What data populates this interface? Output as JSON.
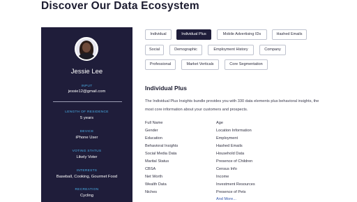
{
  "page": {
    "title": "Discover Our Data Ecosystem"
  },
  "profile": {
    "name": "Jessie Lee",
    "fields": [
      {
        "label": "Input",
        "value": "jessie12@gmail.com"
      },
      {
        "label": "Length of Residence",
        "value": "5 years"
      },
      {
        "label": "Device",
        "value": "iPhone User"
      },
      {
        "label": "Voting Status",
        "value": "Likely Voter"
      },
      {
        "label": "Interests",
        "value": "Baseball, Cooking, Gourmet Food"
      },
      {
        "label": "Recreation",
        "value": "Cycling"
      }
    ]
  },
  "tags": [
    {
      "label": "Individual",
      "active": false
    },
    {
      "label": "Individual Plus",
      "active": true
    },
    {
      "label": "Mobile Advertising IDs",
      "active": false
    },
    {
      "label": "Hashed Emails",
      "active": false
    },
    {
      "label": "Social",
      "active": false
    },
    {
      "label": "Demographic",
      "active": false
    },
    {
      "label": "Employment History",
      "active": false
    },
    {
      "label": "Company",
      "active": false
    },
    {
      "label": "Professional",
      "active": false
    },
    {
      "label": "Market Verticals",
      "active": false
    },
    {
      "label": "Core Segmentation",
      "active": false
    }
  ],
  "section": {
    "title": "Individual Plus",
    "description": "The Individual Plus Insights bundle provides you with 330 data elements plus behavioral insights, the most core information about your customers and prospects.",
    "left_attributes": [
      "Full Name",
      "Gender",
      "Education",
      "Behavioral Insights",
      "Social Media Data",
      "Marital Status",
      "CBSA",
      "Net Worth",
      "Wealth Data",
      "Niches"
    ],
    "right_attributes": [
      "Age",
      "Location Information",
      "Employment",
      "Hashed Emails",
      "Household Data",
      "Presence of Children",
      "Census Info",
      "Income",
      "Investment Resources",
      "Presence of Pets"
    ],
    "more_link": "And More..."
  }
}
